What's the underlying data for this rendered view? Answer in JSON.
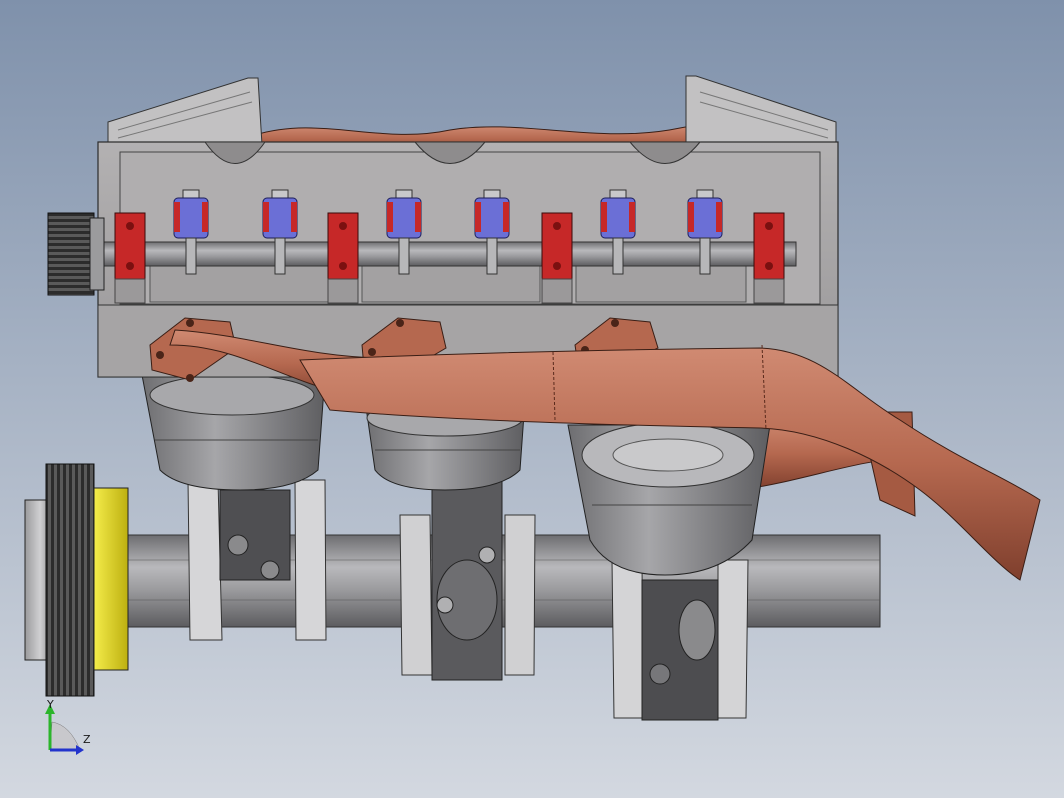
{
  "viewport": {
    "background_top": "#7f91ab",
    "background_bottom": "#d3d8e0"
  },
  "model": {
    "cylinder_count": 3,
    "colors": {
      "block": "#a9a7a8",
      "block_dark": "#7d7b7c",
      "steel": "#8b8b8d",
      "steel_light": "#bdbdbf",
      "manifold": "#b5684f",
      "manifold_dark": "#8c4a36",
      "rocker_bracket": "#c62828",
      "valve_spring": "#6b6fd6",
      "pulley_band": "#e4d818",
      "pulley": "#3a3a3a"
    }
  },
  "triad": {
    "y_label": "Y",
    "z_label": "Z",
    "y_color": "#2bb52b",
    "z_color": "#2233cc"
  }
}
